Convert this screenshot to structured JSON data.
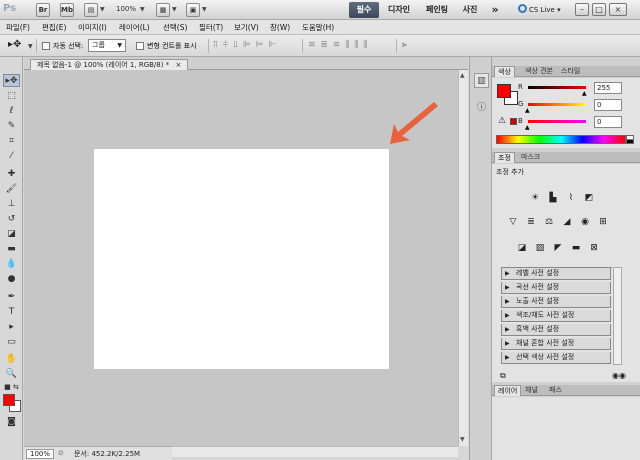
{
  "app": {
    "logo": "Ps",
    "bridge_btn": "Br",
    "minibridge_btn": "Mb",
    "zoom_level": "100%",
    "workspaces": [
      "필수",
      "디자인",
      "페인팅",
      "사진"
    ],
    "more_workspaces": "»",
    "cs_live": "CS Live",
    "win_min": "–",
    "win_max": "□",
    "win_close": "×"
  },
  "menu": [
    "파일(F)",
    "편집(E)",
    "이미지(I)",
    "레이어(L)",
    "선택(S)",
    "필터(T)",
    "보기(V)",
    "창(W)",
    "도움말(H)"
  ],
  "options": {
    "auto_select_label": "자동 선택:",
    "auto_select_value": "그룹",
    "show_transform_label": "변형 컨트롤 표시"
  },
  "document": {
    "tab_title": "제목 없음-1 @ 100% (레이어 1, RGB/8) *",
    "tab_close": "×",
    "zoom": "100%",
    "doc_info": "문서: 452.2K/2.25M",
    "annotation_arrow_color": "#e8623a"
  },
  "color_panel": {
    "tabs": [
      "색상",
      "색상 견본",
      "스타일"
    ],
    "channels": [
      {
        "label": "R",
        "value": "255"
      },
      {
        "label": "G",
        "value": "0"
      },
      {
        "label": "B",
        "value": "0"
      }
    ],
    "foreground": "#ff0000",
    "background": "#ffffff"
  },
  "adjust_panel": {
    "tabs": [
      "조정",
      "마스크"
    ],
    "title": "조정 추가",
    "presets": [
      "레벨 사전 설정",
      "곡선 사전 설정",
      "노출 사전 설정",
      "색조/채도 사전 설정",
      "흑백 사전 설정",
      "채널 혼합 사전 설정",
      "선택 색상 사전 설정"
    ]
  },
  "layers_panel": {
    "tabs": [
      "레이어",
      "채널",
      "패스"
    ]
  }
}
